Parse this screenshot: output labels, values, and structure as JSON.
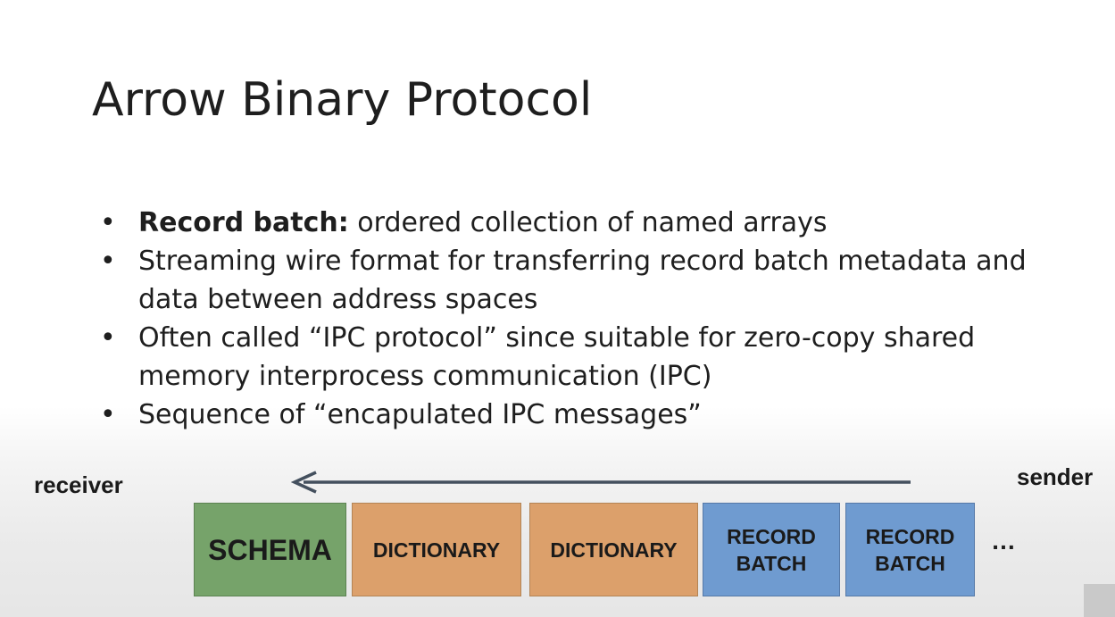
{
  "title": "Arrow Binary Protocol",
  "bullets": [
    {
      "bold": "Record batch:",
      "lines": [
        " ordered collection of named arrays"
      ]
    },
    {
      "bold": "",
      "lines": [
        "Streaming wire format for transferring record batch metadata and",
        "data between address spaces"
      ]
    },
    {
      "bold": "",
      "lines": [
        "Often called “IPC protocol” since suitable for zero-copy shared",
        "memory interprocess communication (IPC)"
      ]
    },
    {
      "bold": "",
      "lines": [
        "Sequence of “encapulated IPC messages”"
      ]
    }
  ],
  "diagram": {
    "receiver_label": "receiver",
    "sender_label": "sender",
    "boxes": [
      {
        "label": "SCHEMA",
        "kind": "schema"
      },
      {
        "label": "DICTIONARY",
        "kind": "dictionary"
      },
      {
        "label": "DICTIONARY",
        "kind": "dictionary"
      },
      {
        "label": "RECORD\nBATCH",
        "kind": "record"
      },
      {
        "label": "RECORD\nBATCH",
        "kind": "record"
      }
    ],
    "ellipsis": "…"
  },
  "colors": {
    "schema": "#76a36a",
    "dictionary": "#dca06b",
    "record": "#6f9bd0",
    "arrow": "#44505e"
  }
}
